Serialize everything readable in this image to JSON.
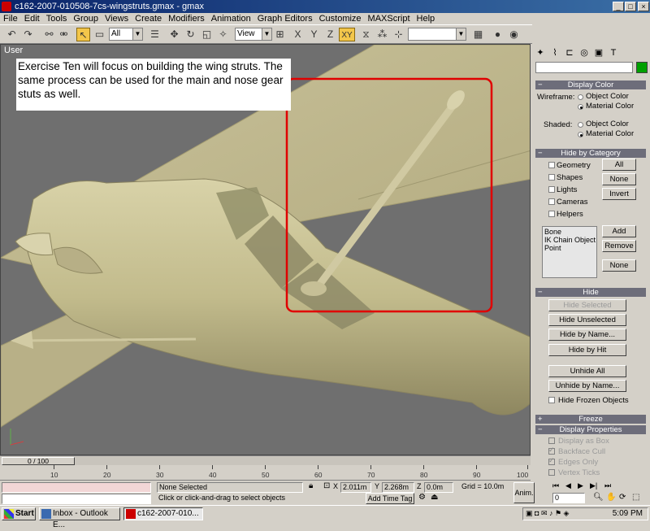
{
  "window": {
    "title": "c162-2007-010508-7cs-wingstruts.gmax - gmax",
    "min": "_",
    "max": "□",
    "close": "×"
  },
  "menu": [
    "File",
    "Edit",
    "Tools",
    "Group",
    "Views",
    "Create",
    "Modifiers",
    "Animation",
    "Graph Editors",
    "Customize",
    "MAXScript",
    "Help"
  ],
  "toolbar": {
    "selection_filter": "All",
    "coord_system": "View",
    "axis_x": "X",
    "axis_y": "Y",
    "axis_z": "Z",
    "axis_xy": "XY"
  },
  "viewport": {
    "label": "User",
    "callout": "Exercise Ten will focus on building the wing struts.  The same process can be used for the main and nose gear stuts as well."
  },
  "command_panel": {
    "display_color": {
      "header": "Display Color",
      "wireframe_label": "Wireframe:",
      "shaded_label": "Shaded:",
      "object_color": "Object Color",
      "material_color": "Material Color"
    },
    "hide_by_category": {
      "header": "Hide by Category",
      "items": [
        "Geometry",
        "Shapes",
        "Lights",
        "Cameras",
        "Helpers"
      ],
      "all": "All",
      "none": "None",
      "invert": "Invert",
      "list": [
        "Bone",
        "IK Chain Object",
        "Point"
      ],
      "add": "Add",
      "remove": "Remove",
      "none2": "None"
    },
    "hide": {
      "header": "Hide",
      "hide_selected": "Hide Selected",
      "hide_unselected": "Hide Unselected",
      "hide_by_name": "Hide by Name...",
      "hide_by_hit": "Hide by Hit",
      "unhide_all": "Unhide All",
      "unhide_by_name": "Unhide by Name...",
      "hide_frozen": "Hide Frozen Objects"
    },
    "freeze": {
      "header": "Freeze"
    },
    "display_properties": {
      "header": "Display Properties",
      "items": [
        "Display as Box",
        "Backface Cull",
        "Edges Only",
        "Vertex Ticks"
      ]
    }
  },
  "timeline": {
    "frame": "0 / 100",
    "ticks": [
      "10",
      "20",
      "30",
      "40",
      "50",
      "60",
      "70",
      "80",
      "90",
      "100"
    ]
  },
  "status": {
    "selection": "None Selected",
    "prompt": "Click or click-and-drag to select objects",
    "x_label": "X",
    "x_value": "2.011m",
    "y_label": "Y",
    "y_value": "2.268m",
    "z_label": "Z",
    "z_value": "0.0m",
    "grid": "Grid = 10.0m",
    "add_time_tag": "Add Time Tag",
    "anim": "Anim.",
    "frame_field": "0"
  },
  "taskbar": {
    "start": "Start",
    "task1": "Inbox - Outlook E...",
    "task2": "c162-2007-010...",
    "clock": "5:09 PM"
  }
}
